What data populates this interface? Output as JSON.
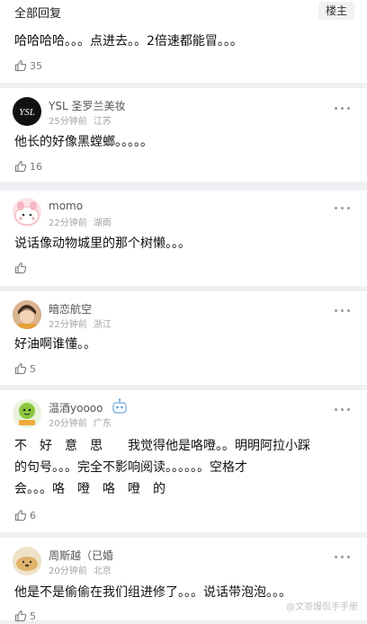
{
  "header": {
    "title": "全部回复",
    "op_button": "楼主"
  },
  "comments": [
    {
      "text": "哈哈哈哈。。。点进去。。2倍速都能冒。。。",
      "likes": "35"
    },
    {
      "username": "YSL 圣罗兰美妆",
      "time": "25分钟前",
      "location": "江苏",
      "avatar_icon": "ysl-logo-avatar",
      "text": "他长的好像黑螳螂。。。。。",
      "likes": "16"
    },
    {
      "username": "momo",
      "time": "22分钟前",
      "location": "湖南",
      "avatar_icon": "pink-cartoon-avatar",
      "text": "说话像动物城里的那个树懒。。。",
      "likes": ""
    },
    {
      "username": "暗恋航空",
      "time": "22分钟前",
      "location": "浙江",
      "avatar_icon": "child-photo-avatar",
      "text": "好油啊谁懂。。",
      "likes": "5"
    },
    {
      "username": "温酒yoooo",
      "time": "20分钟前",
      "location": "广东",
      "avatar_icon": "green-cartoon-avatar",
      "badge_icon": "robot-badge-icon",
      "text": "不　好　意　思　　我觉得他是咯噔。。明明阿拉小踩\n的句号。。。完全不影响阅读。。。。。。空格才\n会。。。咯　噔　咯　噔　的",
      "likes": "6"
    },
    {
      "username": "周斯越（已婚",
      "time": "20分钟前",
      "location": "北京",
      "avatar_icon": "bread-dog-avatar",
      "text": "他是不是偷偷在我们组进修了。。。说话带泡泡。。。",
      "likes": "5"
    }
  ],
  "watermark": "@文哥爆侃手手册"
}
